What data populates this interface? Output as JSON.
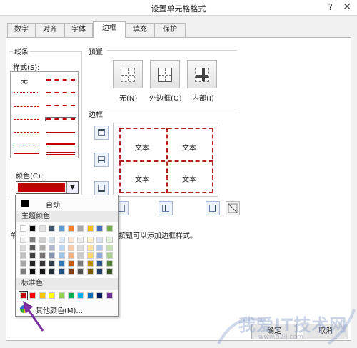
{
  "window": {
    "title": "设置单元格格式",
    "help": "?",
    "close": "✕"
  },
  "tabs": [
    "数字",
    "对齐",
    "字体",
    "边框",
    "填充",
    "保护"
  ],
  "active_tab": 3,
  "line": {
    "section": "线条",
    "style_label": "样式(S):",
    "none_label": "无",
    "color_label": "颜色(C):",
    "selected_color": "#c00000"
  },
  "presets": {
    "section": "预置",
    "buttons": [
      "无(N)",
      "外边框(O)",
      "内部(I)"
    ]
  },
  "border": {
    "section": "边框",
    "cells": [
      "文本",
      "文本",
      "文本",
      "文本"
    ],
    "border_color": "#b32020"
  },
  "hint": "单击预置选项、预览草图及上面的按钮可以添加边框样式。",
  "hint_visible": "按钮可以添加边框样式。",
  "hint_prefix": "单",
  "buttons": {
    "ok": "确定",
    "cancel": "取消"
  },
  "color_popup": {
    "auto_label": "自动",
    "theme_header": "主题颜色",
    "standard_header": "标准色",
    "more_label": "其他颜色(M)...",
    "theme_colors": [
      [
        "#ffffff",
        "#000000",
        "#e7e6e6",
        "#44546a",
        "#5b9bd5",
        "#ed7d31",
        "#a5a5a5",
        "#ffc000",
        "#4472c4",
        "#70ad47"
      ],
      [
        "#f2f2f2",
        "#7f7f7f",
        "#d0cece",
        "#d6dce4",
        "#deebf6",
        "#fbe5d5",
        "#ededed",
        "#fff2cc",
        "#d9e2f3",
        "#e2efd9"
      ],
      [
        "#d8d8d8",
        "#595959",
        "#aeabab",
        "#adb9ca",
        "#bdd7ee",
        "#f7cbac",
        "#dbdbdb",
        "#fee599",
        "#b4c6e7",
        "#c5e0b3"
      ],
      [
        "#bfbfbf",
        "#3f3f3f",
        "#757070",
        "#8496b0",
        "#9dc3e6",
        "#f4b183",
        "#c9c9c9",
        "#ffd965",
        "#8eaadb",
        "#a8d08d"
      ],
      [
        "#a5a5a5",
        "#262626",
        "#3a3838",
        "#323f4f",
        "#2e75b5",
        "#c55a11",
        "#7b7b7b",
        "#bf9000",
        "#2f5496",
        "#538135"
      ],
      [
        "#7f7f7f",
        "#0c0c0c",
        "#171616",
        "#222a35",
        "#1e4e79",
        "#833c0b",
        "#525252",
        "#7f6000",
        "#1f3864",
        "#375623"
      ]
    ],
    "standard_colors": [
      "#c00000",
      "#ff0000",
      "#ffc000",
      "#ffff00",
      "#92d050",
      "#00b050",
      "#00b0f0",
      "#0070c0",
      "#002060",
      "#7030a0"
    ]
  },
  "pointer_color": "#7b2fa0",
  "watermark": {
    "text": "我爱IT技术网",
    "sub": "www.52ij.com"
  }
}
